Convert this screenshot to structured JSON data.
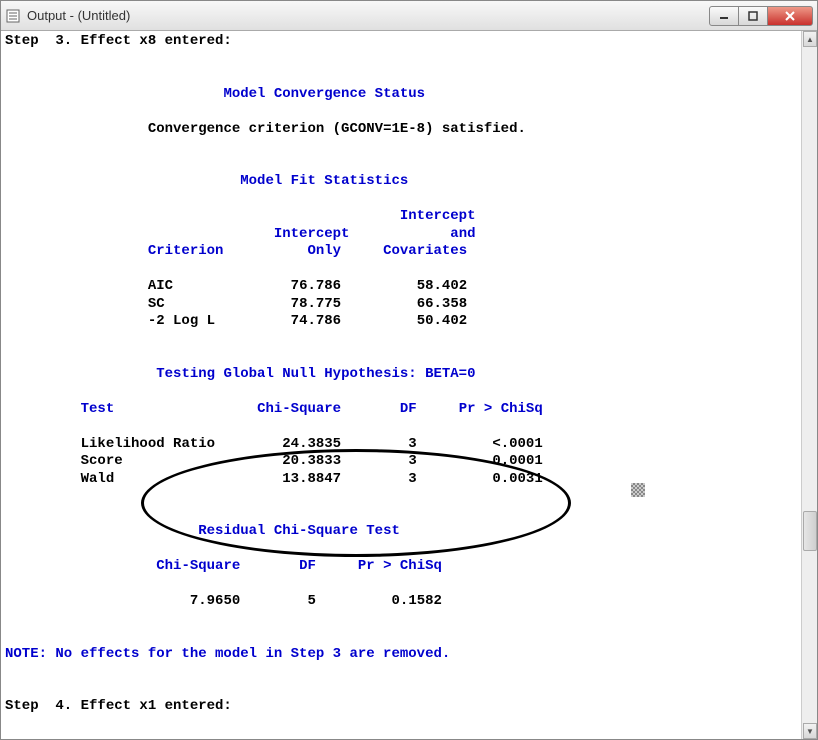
{
  "window": {
    "title": "Output - (Untitled)"
  },
  "step3_line": "Step  3. Effect x8 entered:",
  "conv_header": "Model Convergence Status",
  "conv_text": "Convergence criterion (GCONV=1E-8) satisfied.",
  "fit_header": "Model Fit Statistics",
  "fit_cols": {
    "criterion": "Criterion",
    "intercept_only_a": "Intercept",
    "intercept_only_b": "Only",
    "intercept_cov_a": "Intercept",
    "intercept_cov_b": "and",
    "intercept_cov_c": "Covariates"
  },
  "fit_rows": [
    {
      "name": "AIC",
      "only": "76.786",
      "cov": "58.402"
    },
    {
      "name": "SC",
      "only": "78.775",
      "cov": "66.358"
    },
    {
      "name": "-2 Log L",
      "only": "74.786",
      "cov": "50.402"
    }
  ],
  "global_header": "Testing Global Null Hypothesis: BETA=0",
  "global_cols": {
    "test": "Test",
    "chisq": "Chi-Square",
    "df": "DF",
    "pr": "Pr > ChiSq"
  },
  "global_rows": [
    {
      "test": "Likelihood Ratio",
      "chisq": "24.3835",
      "df": "3",
      "pr": "<.0001"
    },
    {
      "test": "Score",
      "chisq": "20.3833",
      "df": "3",
      "pr": "0.0001"
    },
    {
      "test": "Wald",
      "chisq": "13.8847",
      "df": "3",
      "pr": "0.0031"
    }
  ],
  "residual_header": "Residual Chi-Square Test",
  "residual_cols": {
    "chisq": "Chi-Square",
    "df": "DF",
    "pr": "Pr > ChiSq"
  },
  "residual_row": {
    "chisq": "7.9650",
    "df": "5",
    "pr": "0.1582"
  },
  "note_line": "NOTE: No effects for the model in Step 3 are removed.",
  "step4_line": "Step  4. Effect x1 entered:"
}
